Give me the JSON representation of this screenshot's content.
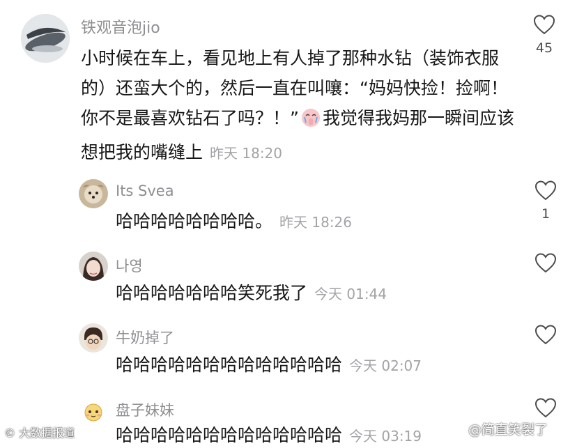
{
  "main_comment": {
    "username": "铁观音泡jio",
    "text_before_emoji": "小时候在车上，看见地上有人掉了那种水钻（装饰衣服的）还蛮大个的，然后一直在叫嚷：“妈妈快捡！捡啊！你不是最喜欢钻石了吗？！”",
    "text_after_emoji": "我觉得我妈那一瞬间应该想把我的嘴缝上",
    "time": "昨天 18:20",
    "likes": "45",
    "emoji_icon": "crying-praying-emoji-icon"
  },
  "replies": [
    {
      "username": "Its Svea",
      "text": "哈哈哈哈哈哈哈哈。",
      "time": "昨天 18:26",
      "likes": "1"
    },
    {
      "username": "나영",
      "text": "哈哈哈哈哈哈哈笑死我了",
      "time": "今天 01:44",
      "likes": ""
    },
    {
      "username": "牛奶掉了",
      "text": "哈哈哈哈哈哈哈哈哈哈哈哈哈",
      "time": "今天 02:07",
      "likes": ""
    },
    {
      "username": "盘子妹妹",
      "text": "哈哈哈哈哈哈哈哈哈哈哈哈哈",
      "time": "今天 03:19",
      "likes": ""
    }
  ],
  "watermarks": {
    "left": "大数据报道",
    "right": "@简直笑裂了"
  },
  "colors": {
    "username": "#8e8e93",
    "time": "#a3a3a8",
    "text": "#161616"
  }
}
